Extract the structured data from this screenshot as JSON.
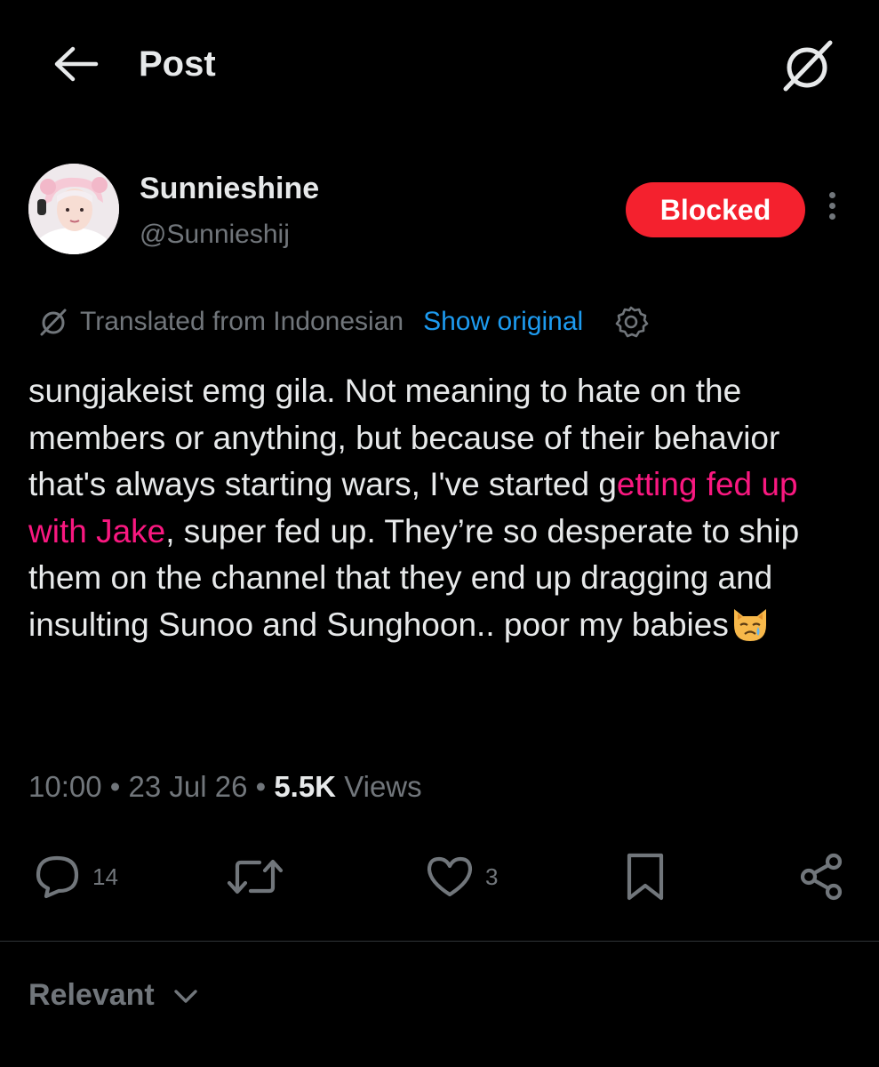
{
  "header": {
    "title": "Post"
  },
  "profile": {
    "display_name": "Sunnieshine",
    "handle": "@Sunnieshij",
    "blocked_label": "Blocked"
  },
  "translation": {
    "label": "Translated from Indonesian",
    "show_original": "Show original"
  },
  "post": {
    "text_before": "sungjakeist emg gila. Not meaning to hate on the members or anything, but because of their behavior that's always starting wars, I've started g",
    "text_highlight": "etting fed up with Jake",
    "text_after": ", super fed up. They’re so desperate to ship them on the channel that they end up dragging and insulting Sunoo and Sunghoon.. poor my babies"
  },
  "meta": {
    "time": "10:00",
    "sep1": " • ",
    "date": "23 Jul 26",
    "sep2": " • ",
    "views_count": "5.5K",
    "views_label": " Views"
  },
  "actions": {
    "replies": "14",
    "likes": "3"
  },
  "sort": {
    "label": "Relevant"
  },
  "colors": {
    "background": "#000000",
    "text": "#e7e9ea",
    "muted": "#71767b",
    "link": "#1d9bf0",
    "highlight": "#f91880",
    "blocked": "#f4212e"
  },
  "icons": [
    "back-arrow-icon",
    "translate-icon",
    "more-icon",
    "settings-icon",
    "crying-cat-emoji",
    "reply-icon",
    "repost-icon",
    "like-icon",
    "bookmark-icon",
    "share-icon",
    "chevron-down-icon"
  ]
}
